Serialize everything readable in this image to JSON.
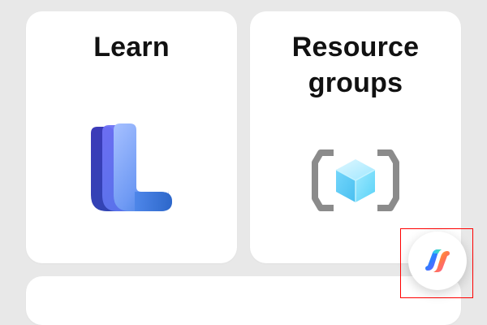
{
  "tiles": [
    {
      "title": "Learn",
      "icon": "learn-icon"
    },
    {
      "title_line1": "Resource",
      "title_line2": "groups",
      "icon": "resource-groups-icon"
    }
  ],
  "fab": {
    "icon": "copilot-icon"
  },
  "colors": {
    "background": "#e8e8e8",
    "tile": "#ffffff",
    "title": "#111111",
    "highlight": "#ff0000"
  }
}
